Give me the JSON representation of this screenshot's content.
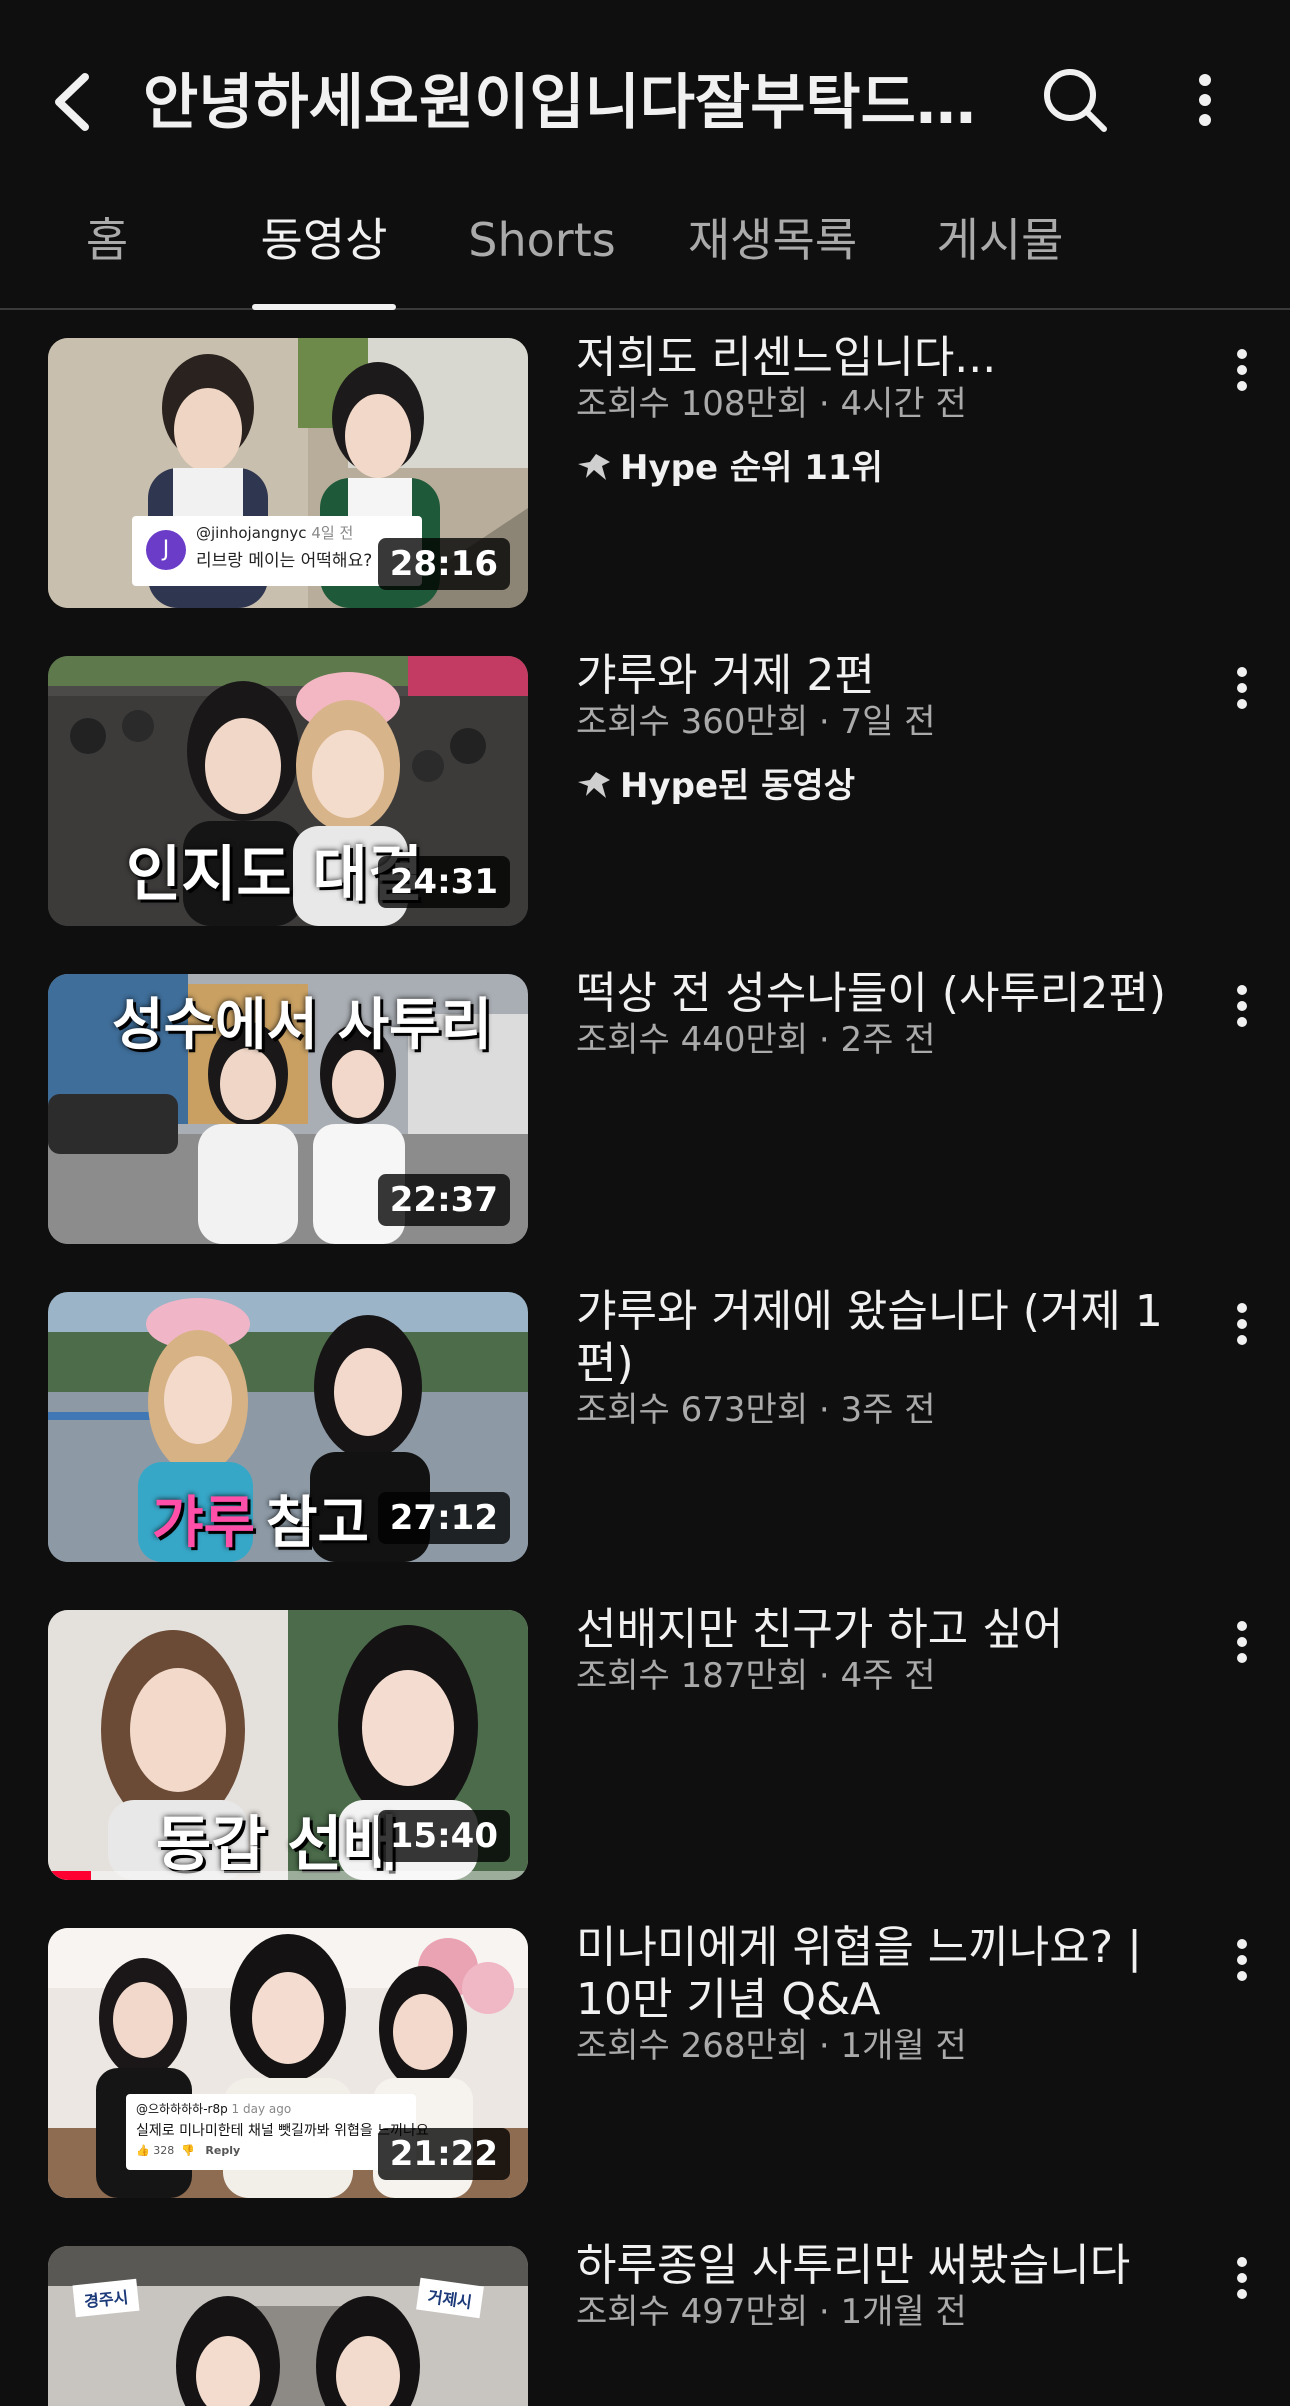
{
  "header": {
    "channel_title": "안녕하세요원이입니다잘부탁드리겠습니다",
    "back_icon": "arrow-back-icon",
    "search_icon": "search-icon",
    "more_icon": "more-vert-icon"
  },
  "tabs": [
    {
      "label": "홈",
      "active": false
    },
    {
      "label": "동영상",
      "active": true
    },
    {
      "label": "Shorts",
      "active": false
    },
    {
      "label": "재생목록",
      "active": false
    },
    {
      "label": "게시물",
      "active": false
    }
  ],
  "videos": [
    {
      "title": "저희도 리센느입니다...",
      "meta": "조회수 108만회 · 4시간 전",
      "badge": "Hype 순위 11위",
      "duration": "28:16",
      "comment": {
        "avatar_letter": "J",
        "handle": "@jinhojangnyc",
        "ago": "4일 전",
        "text": "리브랑 메이는 어떡해요?"
      }
    },
    {
      "title": "갸루와 거제 2편",
      "meta": "조회수 360만회 · 7일 전",
      "badge": "Hype된 동영상",
      "duration": "24:31",
      "overlay": "인지도 대결"
    },
    {
      "title": "떡상 전 성수나들이 (사투리2편)",
      "meta": "조회수 440만회 · 2주 전",
      "duration": "22:37",
      "overlay": "성수에서 사투리"
    },
    {
      "title": "갸루와 거제에 왔습니다 (거제 1편)",
      "meta": "조회수 673만회 · 3주 전",
      "duration": "27:12",
      "overlay_pink": "갸루",
      "overlay": "참고"
    },
    {
      "title": "선배지만 친구가 하고 싶어",
      "meta": "조회수 187만회 · 4주 전",
      "duration": "15:40",
      "overlay": "동갑 선배",
      "watched_fraction": 0.09
    },
    {
      "title": "미나미에게 위협을 느끼나요? | 10만 기념 Q&A",
      "meta": "조회수 268만회 · 1개월 전",
      "duration": "21:22",
      "comment2": {
        "handle": "@으하하하하-r8p",
        "ago": "1 day ago",
        "text": "실제로 미나미한테 채널 뺏길까봐 위협을 느끼나요",
        "likes": "328",
        "reply": "Reply"
      }
    },
    {
      "title": "하루종일 사투리만 써봤습니다",
      "meta": "조회수 497만회 · 1개월 전",
      "sign_left": "경주시",
      "sign_right": "거제시"
    }
  ]
}
